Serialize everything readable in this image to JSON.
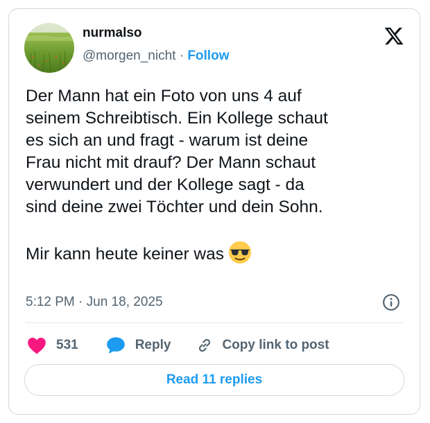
{
  "author": {
    "display_name": "nurmalso",
    "handle": "@morgen_nicht",
    "separator": " · ",
    "follow_label": "Follow",
    "avatar_icon": "grass-field-avatar"
  },
  "tweet": {
    "text": "Der Mann hat ein Foto von uns 4 auf\nseinem Schreibtisch. Ein Kollege schaut\nes sich an und fragt - warum ist deine\nFrau nicht mit drauf? Der Mann schaut\nverwundert und der Kollege sagt - da\nsind deine zwei Töchter und dein Sohn.",
    "closing_line": "Mir kann heute keiner was",
    "emoji_icon": "sunglasses-face-emoji",
    "timestamp": "5:12 PM · Jun 18, 2025"
  },
  "actions": {
    "like_count": "531",
    "reply_label": "Reply",
    "copy_link_label": "Copy link to post"
  },
  "footer": {
    "read_replies_label": "Read 11 replies"
  },
  "colors": {
    "accent": "#1d9bf0",
    "like": "#f91880",
    "text": "#0f1419",
    "muted": "#536471",
    "border": "#cfd9de"
  }
}
